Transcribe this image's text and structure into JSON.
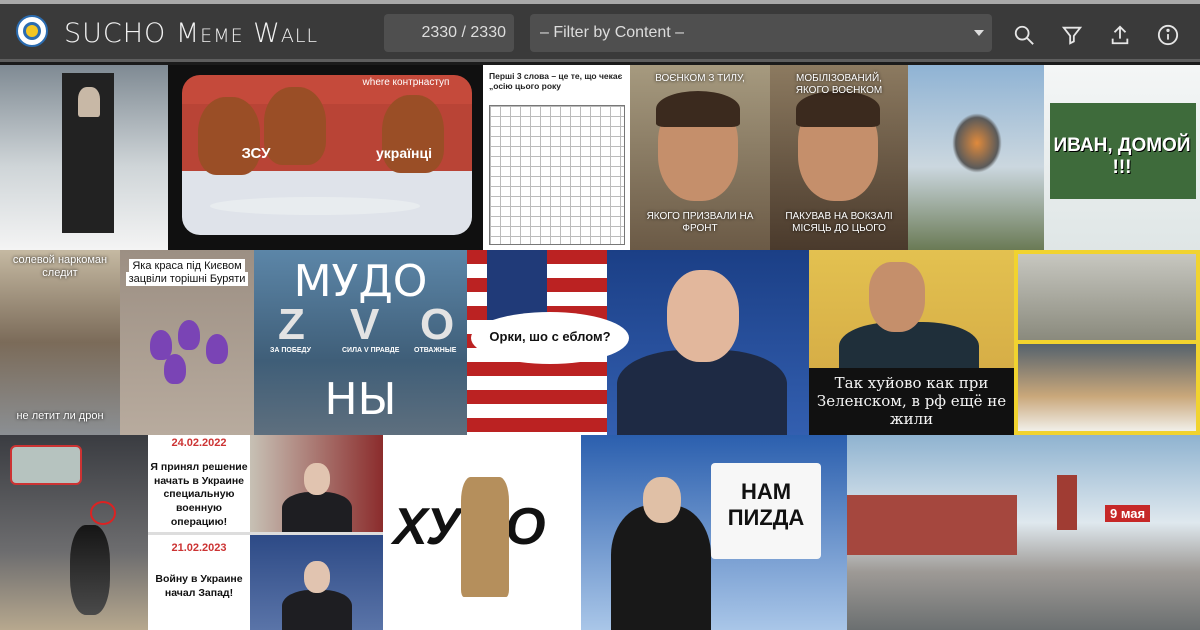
{
  "header": {
    "title": "SUCHO Meme Wall",
    "counter": "2330 / 2330",
    "filter": {
      "selected": "– Filter by Content –"
    },
    "icons": [
      "search-icon",
      "filter-icon",
      "upload-icon",
      "info-icon"
    ]
  },
  "tiles": {
    "ape": {
      "caption_left": "ЗСУ",
      "caption_right": "українці",
      "banner": "where контрнаступ"
    },
    "wordsearch": {
      "heading": "Перші 3 слова – це те, що чекає „осію цього року"
    },
    "cage1": {
      "top": "ВОЄНКОМ З ТИЛУ,",
      "bottom": "ЯКОГО ПРИЗВАЛИ НА ФРОНТ"
    },
    "cage2": {
      "top": "МОБІЛІЗОВАНИЙ, ЯКОГО ВОЄНКОМ",
      "bottom": "ПАКУВАВ НА ВОКЗАЛІ МІСЯЦЬ ДО ЦЬОГО"
    },
    "train": {
      "text": "ИВАН, ДОМОЙ !!!"
    },
    "moscow": {
      "top": "солевой наркоман следит",
      "bottom": "не летит ли дрон"
    },
    "flower": {
      "text": "Яка краса під Києвом зацвіли торішні Буряти"
    },
    "mudo": {
      "line1": "МУДО",
      "z": "Z",
      "v": "V",
      "o": "O",
      "za": "ЗА ПОБЕДУ",
      "sila": "СИЛА V ПРАВДЕ",
      "otv": "ОТВАЖНЫЕ",
      "line3": "НЫ"
    },
    "biden": {
      "bubble": "Орки, шо с еблом?"
    },
    "zel": {
      "text": "Так хуйово как при Зеленском, в рф ещё не жили"
    },
    "putin": {
      "date1": "24.02.2022",
      "text1": "Я принял решение начать в Украине специальную военную операцию!",
      "date2": "21.02.2023",
      "text2": "Войну в Украине начал Запад!"
    },
    "hulo": {
      "word": "ХУ ЛО"
    },
    "news": {
      "sign": "НАМ ПИZДА"
    },
    "kremlin": {
      "badge": "9 мая"
    }
  }
}
